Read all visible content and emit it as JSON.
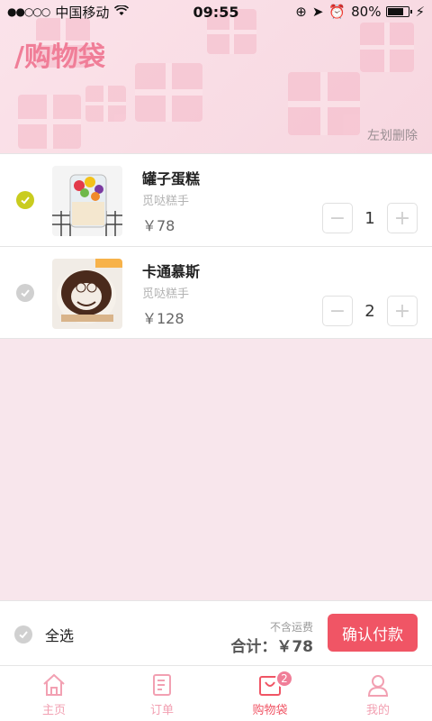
{
  "status_bar": {
    "carrier": "中国移动",
    "time": "09:55",
    "battery": "80%",
    "battery_level": 0.8
  },
  "header": {
    "title": "/购物袋",
    "swipe_hint": "左划删除"
  },
  "cart": {
    "items": [
      {
        "name": "罐子蛋糕",
        "shop": "觅哒糕手",
        "price": "￥78",
        "quantity": "1",
        "selected": true
      },
      {
        "name": "卡通慕斯",
        "shop": "觅哒糕手",
        "price": "￥128",
        "quantity": "2",
        "selected": false
      }
    ]
  },
  "footer": {
    "select_all": "全选",
    "shipping_note": "不含运费",
    "total": "合计：￥78",
    "confirm": "确认付款"
  },
  "tabs": [
    {
      "label": "主页",
      "icon": "home-icon"
    },
    {
      "label": "订单",
      "icon": "order-icon"
    },
    {
      "label": "购物袋",
      "icon": "bag-icon",
      "badge": "2"
    },
    {
      "label": "我的",
      "icon": "user-icon"
    }
  ],
  "colors": {
    "accent": "#f05565",
    "selected_check": "#c9cc1f",
    "unselected_check": "#d0d0d0",
    "title_pink": "#f07e98"
  }
}
